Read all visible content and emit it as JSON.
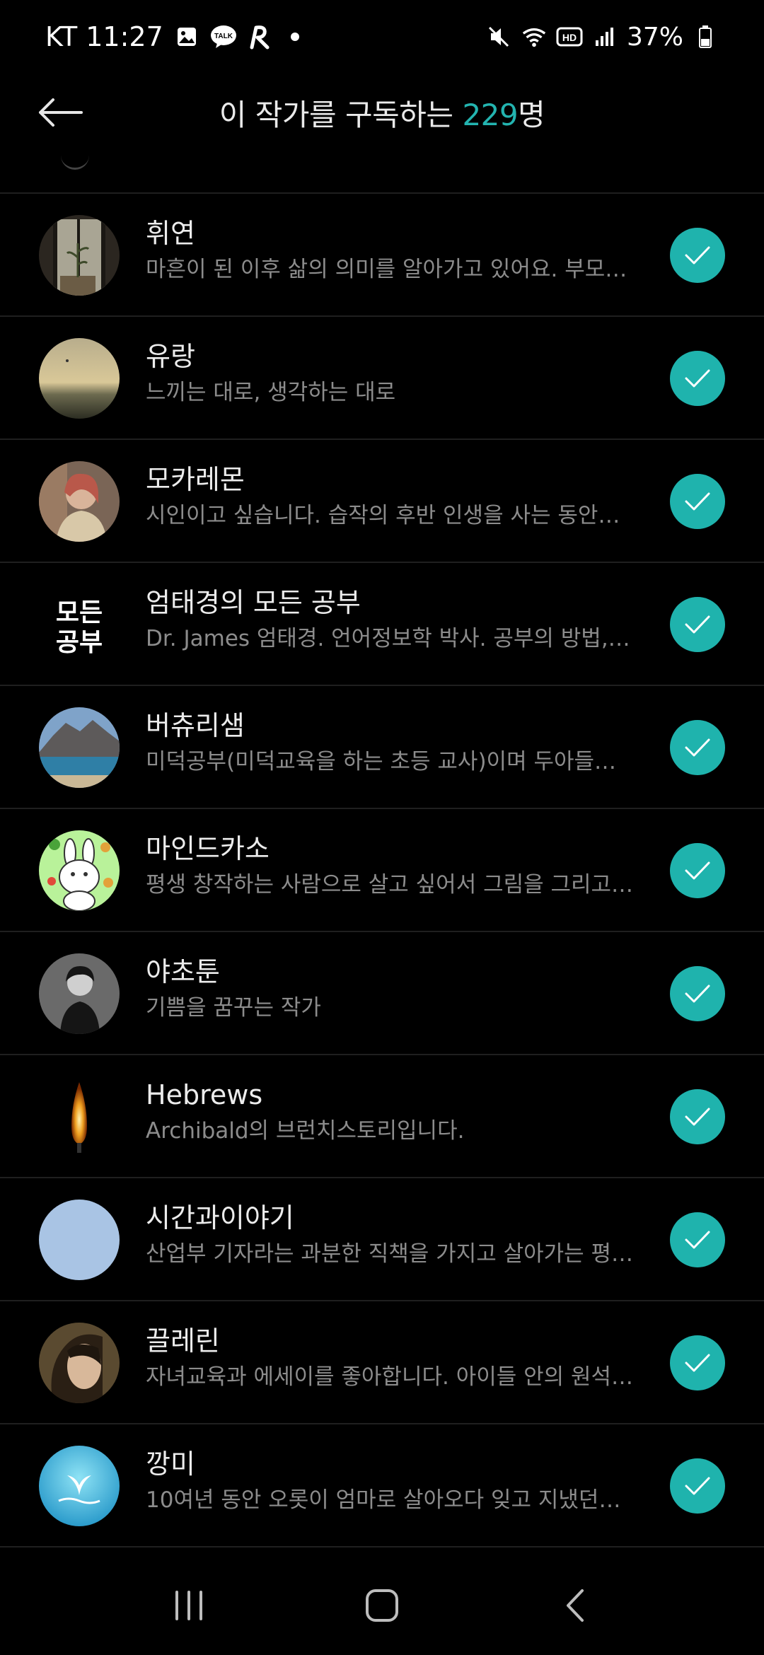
{
  "status_bar": {
    "carrier_time": "KT 11:27",
    "battery": "37%"
  },
  "header": {
    "title_prefix": "이 작가를 구독하는 ",
    "count": "229",
    "title_suffix": "명"
  },
  "colors": {
    "accent": "#1fb3ad",
    "background": "#000000"
  },
  "subscribers": [
    {
      "name": "휘연",
      "desc": "마흔이 된 이후 삶의 의미를 알아가고 있어요. 부모…",
      "avatar": "window-plant"
    },
    {
      "name": "유랑",
      "desc": "느끼는 대로, 생각하는 대로",
      "avatar": "sunset"
    },
    {
      "name": "모카레몬",
      "desc": "시인이고 싶습니다. 습작의 후반 인생을 사는 동안…",
      "avatar": "portrait"
    },
    {
      "name": "엄태경의 모든 공부",
      "desc": "Dr. James 엄태경. 언어정보학 박사. 공부의 방법,…",
      "avatar": "text-logo",
      "avatar_text_top": "모든",
      "avatar_text_bottom": "공부"
    },
    {
      "name": "버츄리샘",
      "desc": "미덕공부(미덕교육을 하는 초등 교사)이며  두아들…",
      "avatar": "mountain-lake"
    },
    {
      "name": "마인드카소",
      "desc": "평생 창작하는 사람으로 살고 싶어서 그림을 그리고…",
      "avatar": "rabbit"
    },
    {
      "name": "야초툰",
      "desc": "기쁨을 꿈꾸는 작가",
      "avatar": "bw-portrait"
    },
    {
      "name": "Hebrews",
      "desc": "Archibald의 브런치스토리입니다.",
      "avatar": "candle"
    },
    {
      "name": "시간과이야기",
      "desc": "산업부 기자라는 과분한 직책을 가지고 살아가는 평…",
      "avatar": "plain-blue"
    },
    {
      "name": "끌레린",
      "desc": "자녀교육과 에세이를 좋아합니다. 아이들 안의 원석…",
      "avatar": "face"
    },
    {
      "name": "깡미",
      "desc": "10여년 동안 오롯이 엄마로 살아오다 잊고 지냈던…",
      "avatar": "whale-tail"
    }
  ]
}
